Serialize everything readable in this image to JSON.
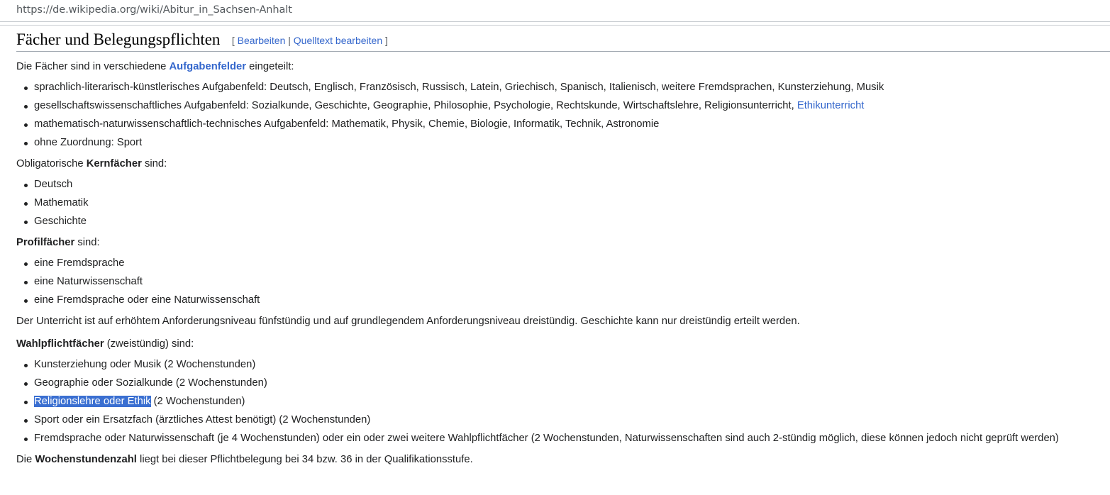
{
  "browser": {
    "url": "https://de.wikipedia.org/wiki/Abitur_in_Sachsen-Anhalt"
  },
  "section": {
    "title": "Fächer und Belegungspflichten",
    "edit_open": "[",
    "edit_link": "Bearbeiten",
    "edit_sep": "|",
    "source_link": "Quelltext bearbeiten",
    "edit_close": "]"
  },
  "p1": {
    "pre": "Die Fächer sind in verschiedene ",
    "link": "Aufgabenfelder",
    "post": " eingeteilt:"
  },
  "fields": [
    {
      "text": "sprachlich-literarisch-künstlerisches Aufgabenfeld: Deutsch, Englisch, Französisch, Russisch, Latein, Griechisch, Spanisch, Italienisch, weitere Fremdsprachen, Kunsterziehung, Musik"
    },
    {
      "text": "gesellschaftswissenschaftliches Aufgabenfeld: Sozialkunde, Geschichte, Geographie, Philosophie, Psychologie, Rechtskunde, Wirtschaftslehre, Religionsunterricht, ",
      "link": "Ethikunterricht"
    },
    {
      "text": "mathematisch-naturwissenschaftlich-technisches Aufgabenfeld: Mathematik, Physik, Chemie, Biologie, Informatik, Technik, Astronomie"
    },
    {
      "text": "ohne Zuordnung: Sport"
    }
  ],
  "p2": {
    "pre": "Obligatorische ",
    "bold": "Kernfächer",
    "post": " sind:"
  },
  "core": [
    "Deutsch",
    "Mathematik",
    "Geschichte"
  ],
  "p3": {
    "bold": "Profilfächer",
    "post": " sind:"
  },
  "profile": [
    "eine Fremdsprache",
    "eine Naturwissenschaft",
    "eine Fremdsprache oder eine Naturwissenschaft"
  ],
  "p4": "Der Unterricht ist auf erhöhtem Anforderungsniveau fünfstündig und auf grundlegendem Anforderungsniveau dreistündig. Geschichte kann nur dreistündig erteilt werden.",
  "p5": {
    "bold": "Wahlpflichtfächer",
    "post": " (zweistündig) sind:"
  },
  "electives": {
    "e1": "Kunsterziehung oder Musik (2 Wochenstunden)",
    "e2": "Geographie oder Sozialkunde (2 Wochenstunden)",
    "e3_selected": "Religionslehre oder Ethik",
    "e3_rest": " (2 Wochenstunden)",
    "e4": "Sport oder ein Ersatzfach (ärztliches Attest benötigt) (2 Wochenstunden)",
    "e5": "Fremdsprache oder Naturwissenschaft (je 4 Wochenstunden) oder ein oder zwei weitere Wahlpflichtfächer (2 Wochenstunden, Naturwissenschaften sind auch 2-stündig möglich, diese können jedoch nicht geprüft werden)"
  },
  "p6": {
    "pre": "Die ",
    "bold": "Wochenstundenzahl",
    "post": " liegt bei dieser Pflichtbelegung bei 34 bzw. 36 in der Qualifikationsstufe."
  },
  "colors": {
    "link": "#3366cc",
    "selection": "#3a6fd1",
    "text": "#202122"
  }
}
